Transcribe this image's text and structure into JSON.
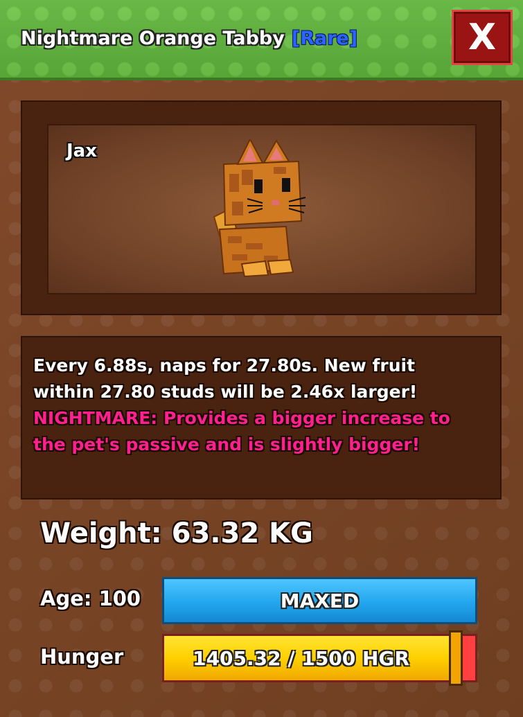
{
  "header": {
    "pet_title": "Nightmare Orange Tabby",
    "rarity": "[Rare]",
    "close_label": "X"
  },
  "pet": {
    "nickname": "Jax",
    "model": "orange-tabby-cat"
  },
  "description": {
    "lines": [
      "Every 6.88s, naps for 27.80s. New fruit",
      "within 27.80 studs will be 2.46x larger!"
    ],
    "mutation_lines": [
      "NIGHTMARE: Provides a bigger increase to",
      "the pet's passive and is slightly bigger!"
    ]
  },
  "stats": {
    "weight": "Weight: 63.32 KG",
    "age_label": "Age: 100",
    "age_bar_text": "MAXED",
    "hunger_label": "Hunger",
    "hunger_text": "1405.32 / 1500 HGR",
    "hunger_fraction": 0.937
  },
  "colors": {
    "rarity": "#2b63ff",
    "mutation": "#ff1f8e",
    "age_bar": "#22a6ee",
    "hunger_fill": "#ffd000",
    "hunger_empty": "#ff4040",
    "close_button": "#9b1414"
  }
}
